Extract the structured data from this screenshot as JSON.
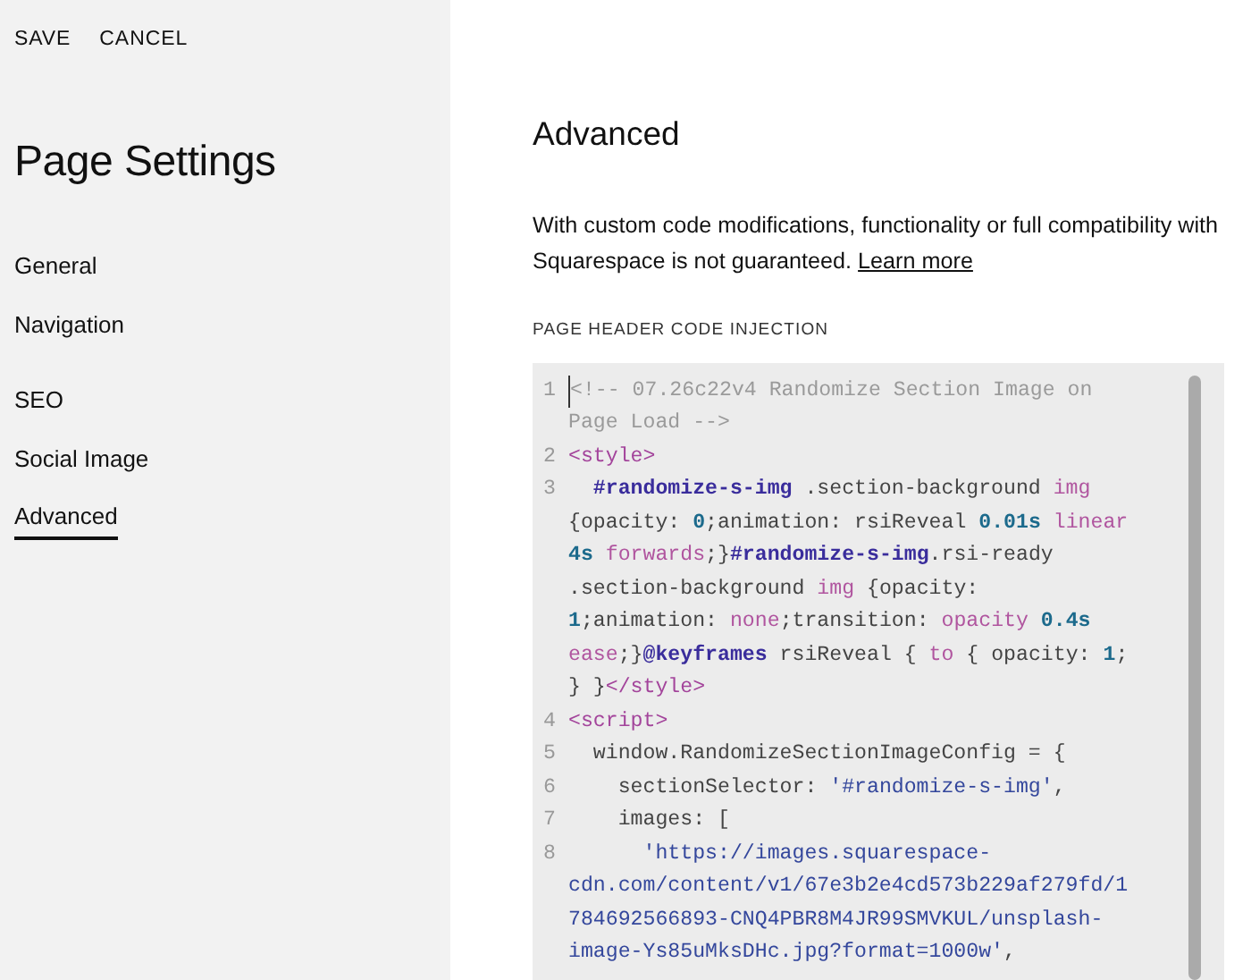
{
  "toolbar": {
    "actions": [
      "SAVE",
      "CANCEL"
    ]
  },
  "sidebar": {
    "title": "Page Settings",
    "groups": [
      [
        {
          "label": "General",
          "selected": false
        },
        {
          "label": "Navigation",
          "selected": false
        }
      ],
      [
        {
          "label": "SEO",
          "selected": false
        },
        {
          "label": "Social Image",
          "selected": false
        },
        {
          "label": "Advanced",
          "selected": true
        }
      ]
    ]
  },
  "main": {
    "title": "Advanced",
    "description": {
      "text": "With custom code modifications, functionality or full compatibility with Squarespace is not guaranteed.",
      "link": "Learn more"
    },
    "section_label": "PAGE HEADER CODE INJECTION",
    "code_lines": [
      {
        "number": "1",
        "wrapped": [
          {
            "tokens": [
              {
                "kind": "comment",
                "text": "<!-- 07.26c22v4 Randomize Section Image on"
              }
            ]
          },
          {
            "tokens": [
              {
                "kind": "comment",
                "text": "Page Load -->"
              }
            ]
          }
        ]
      },
      {
        "number": "2",
        "wrapped": [
          {
            "tokens": [
              {
                "kind": "tag",
                "text": "<style>"
              }
            ]
          }
        ]
      },
      {
        "number": "3",
        "wrapped": [
          {
            "tokens": [
              {
                "kind": "id",
                "text": "  #randomize-s-img"
              },
              {
                "kind": "plain",
                "text": " .section-background "
              },
              {
                "kind": "keyword",
                "text": "img"
              }
            ]
          },
          {
            "tokens": [
              {
                "kind": "plain",
                "text": "{opacity: "
              },
              {
                "kind": "number",
                "text": "0"
              },
              {
                "kind": "plain",
                "text": ";animation: rsiReveal "
              },
              {
                "kind": "number",
                "text": "0.01s"
              },
              {
                "kind": "keyword",
                "text": " linear"
              }
            ]
          },
          {
            "tokens": [
              {
                "kind": "number",
                "text": "4s"
              },
              {
                "kind": "keyword",
                "text": " forwards"
              },
              {
                "kind": "plain",
                "text": ";}"
              },
              {
                "kind": "id",
                "text": "#randomize-s-img"
              },
              {
                "kind": "plain",
                "text": ".rsi-ready"
              }
            ]
          },
          {
            "tokens": [
              {
                "kind": "plain",
                "text": ".section-background "
              },
              {
                "kind": "keyword",
                "text": "img"
              },
              {
                "kind": "plain",
                "text": " {opacity:"
              }
            ]
          },
          {
            "tokens": [
              {
                "kind": "number",
                "text": "1"
              },
              {
                "kind": "plain",
                "text": ";animation: "
              },
              {
                "kind": "keyword",
                "text": "none"
              },
              {
                "kind": "plain",
                "text": ";transition: "
              },
              {
                "kind": "keyword",
                "text": "opacity"
              },
              {
                "kind": "number",
                "text": " 0.4s"
              }
            ]
          },
          {
            "tokens": [
              {
                "kind": "keyword",
                "text": "ease"
              },
              {
                "kind": "plain",
                "text": ";}"
              },
              {
                "kind": "id",
                "text": "@keyframes"
              },
              {
                "kind": "plain",
                "text": " rsiReveal { "
              },
              {
                "kind": "keyword",
                "text": "to"
              },
              {
                "kind": "plain",
                "text": " { opacity: "
              },
              {
                "kind": "number",
                "text": "1"
              },
              {
                "kind": "plain",
                "text": ";"
              }
            ]
          },
          {
            "tokens": [
              {
                "kind": "plain",
                "text": "} }"
              },
              {
                "kind": "tag",
                "text": "</style>"
              }
            ]
          }
        ]
      },
      {
        "number": "4",
        "wrapped": [
          {
            "tokens": [
              {
                "kind": "tag",
                "text": "<script>"
              }
            ]
          }
        ]
      },
      {
        "number": "5",
        "wrapped": [
          {
            "tokens": [
              {
                "kind": "plain",
                "text": "  window.RandomizeSectionImageConfig = {"
              }
            ]
          }
        ]
      },
      {
        "number": "6",
        "wrapped": [
          {
            "tokens": [
              {
                "kind": "plain",
                "text": "    sectionSelector: "
              },
              {
                "kind": "string",
                "text": "'#randomize-s-img'"
              },
              {
                "kind": "plain",
                "text": ","
              }
            ]
          }
        ]
      },
      {
        "number": "7",
        "wrapped": [
          {
            "tokens": [
              {
                "kind": "plain",
                "text": "    images: ["
              }
            ]
          }
        ]
      },
      {
        "number": "8",
        "wrapped": [
          {
            "tokens": [
              {
                "kind": "string",
                "text": "      'https://images.squarespace-"
              }
            ]
          },
          {
            "tokens": [
              {
                "kind": "string",
                "text": "cdn.com/content/v1/67e3b2e4cd573b229af279fd/1"
              }
            ]
          },
          {
            "tokens": [
              {
                "kind": "string",
                "text": "784692566893-CNQ4PBR8M4JR99SMVKUL/unsplash-"
              }
            ]
          },
          {
            "tokens": [
              {
                "kind": "string",
                "text": "image-Ys85uMksDHc.jpg?format=1000w'"
              },
              {
                "kind": "plain",
                "text": ","
              }
            ]
          }
        ]
      }
    ]
  }
}
